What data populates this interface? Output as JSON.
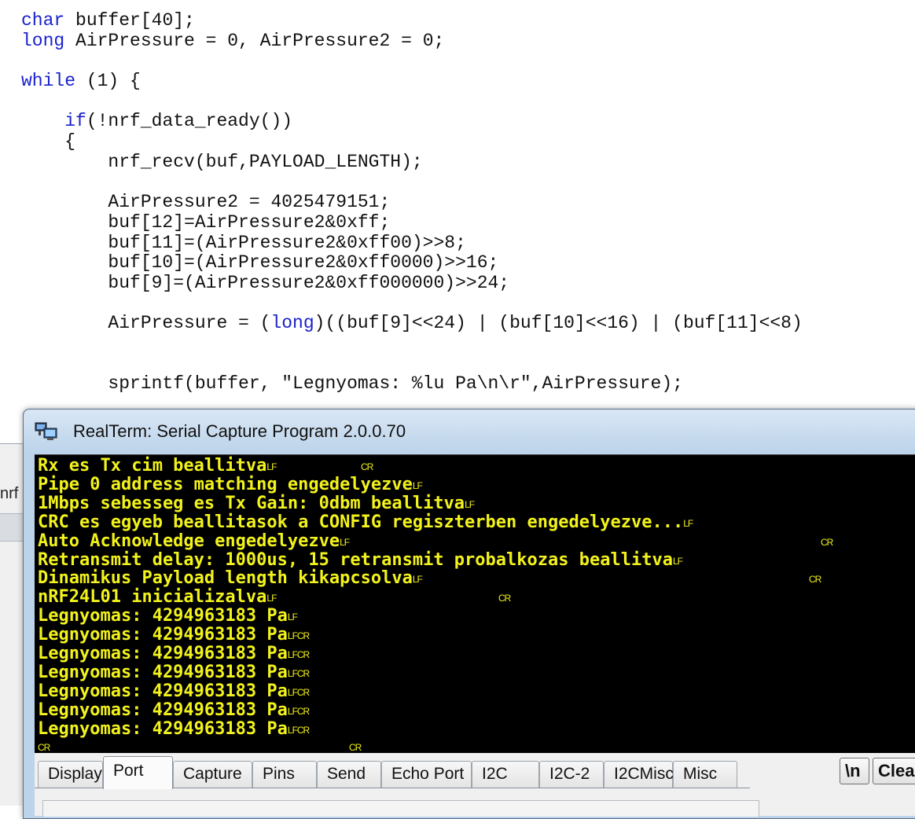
{
  "code": {
    "lines": [
      "char buffer[40];",
      "long AirPressure = 0, AirPressure2 = 0;",
      "",
      "while (1) {",
      "",
      "    if(!nrf_data_ready())",
      "    {",
      "        nrf_recv(buf,PAYLOAD_LENGTH);",
      "",
      "        AirPressure2 = 4025479151;",
      "        buf[12]=AirPressure2&0xff;",
      "        buf[11]=(AirPressure2&0xff00)>>8;",
      "        buf[10]=(AirPressure2&0xff0000)>>16;",
      "        buf[9]=(AirPressure2&0xff000000)>>24;",
      "",
      "        AirPressure = (long)((buf[9]<<24) | (buf[10]<<16) | (buf[11]<<8)",
      "",
      "",
      "        sprintf(buffer, \"Legnyomas: %lu Pa\\n\\r\",AirPressure);"
    ],
    "keywords": [
      "char",
      "long",
      "while",
      "if"
    ]
  },
  "background_window": {
    "fragment_text": "nrf"
  },
  "realterm": {
    "title": "RealTerm: Serial Capture Program 2.0.0.70",
    "icon": "realterm-app-icon",
    "colors": {
      "terminal_bg": "#000000",
      "terminal_fg": "#f2f21c"
    },
    "terminal_lines": [
      {
        "text": "Rx es Tx cim beallitva",
        "ctl": "LF",
        "gap_cr": "CR"
      },
      {
        "text": "Pipe 0 address matching engedelyezve",
        "ctl": "LF"
      },
      {
        "text": "1Mbps sebesseg es Tx Gain: 0dbm beallitva",
        "ctl": "LF"
      },
      {
        "text": "CRC es egyeb beallitasok a CONFIG regiszterben engedelyezve...",
        "ctl": "LF"
      },
      {
        "text": "Auto Acknowledge engedelyezve",
        "ctl": "LF",
        "gap_cr": "CR"
      },
      {
        "text": "Retransmit delay: 1000us, 15 retransmit probalkozas beallitva",
        "ctl": "LF"
      },
      {
        "text": "Dinamikus Payload length kikapcsolva",
        "ctl": "LF",
        "gap_cr": "CR"
      },
      {
        "text": "nRF24L01 inicializalva",
        "ctl": "LF",
        "gap_cr": "CR"
      },
      {
        "text": "Legnyomas: 4294963183 Pa",
        "ctl": "LF"
      },
      {
        "text": "Legnyomas: 4294963183 Pa",
        "ctl": "LFCR"
      },
      {
        "text": "Legnyomas: 4294963183 Pa",
        "ctl": "LFCR"
      },
      {
        "text": "Legnyomas: 4294963183 Pa",
        "ctl": "LFCR"
      },
      {
        "text": "Legnyomas: 4294963183 Pa",
        "ctl": "LFCR"
      },
      {
        "text": "Legnyomas: 4294963183 Pa",
        "ctl": "LFCR"
      },
      {
        "text": "Legnyomas: 4294963183 Pa",
        "ctl": "LFCR"
      }
    ],
    "last_line": {
      "left_ctl": "CR",
      "right_ctl": "CR"
    },
    "tabs": [
      "Display",
      "Port",
      "Capture",
      "Pins",
      "Send",
      "Echo Port",
      "I2C",
      "I2C-2",
      "I2CMisc",
      "Misc"
    ],
    "active_tab": "Port",
    "buttons": [
      "\\n",
      "Clear"
    ]
  }
}
